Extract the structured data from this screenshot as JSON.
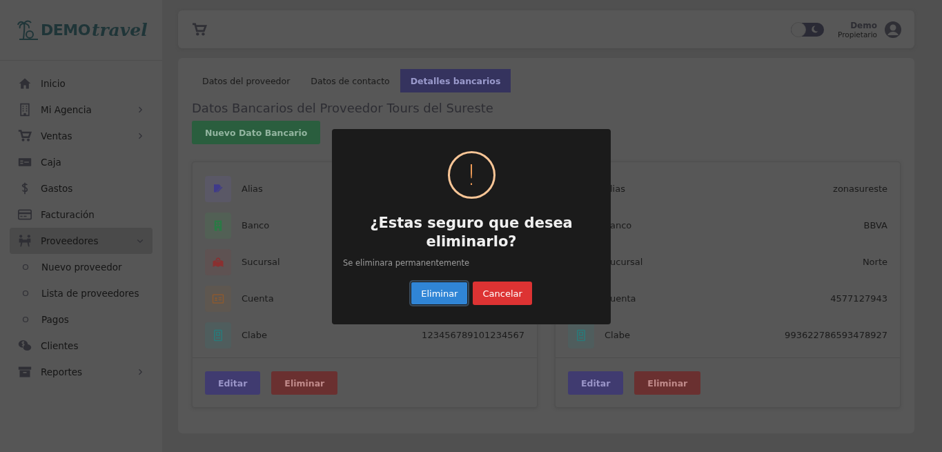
{
  "logo": {
    "text": "DEMO",
    "script": "travel"
  },
  "sidebar": {
    "items": [
      {
        "label": "Inicio",
        "selected": false
      },
      {
        "label": "Mi Agencia",
        "selected": false,
        "expanded": false
      },
      {
        "label": "Ventas",
        "selected": false,
        "expanded": false
      },
      {
        "label": "Caja",
        "selected": false
      },
      {
        "label": "Gastos",
        "selected": false
      },
      {
        "label": "Facturación",
        "selected": false
      },
      {
        "label": "Proveedores",
        "selected": true,
        "expanded": true,
        "children": [
          {
            "label": "Nuevo proveedor",
            "selected": false
          },
          {
            "label": "Lista de proveedores",
            "selected": false
          },
          {
            "label": "Pagos",
            "selected": false
          }
        ]
      },
      {
        "label": "Clientes",
        "selected": false
      },
      {
        "label": "Reportes",
        "selected": false,
        "expanded": false
      }
    ]
  },
  "header": {
    "theme_toggle": {
      "on": false
    },
    "user": {
      "name": "Demo",
      "role": "Propietario"
    }
  },
  "tabs": [
    {
      "label": "Datos del proveedor",
      "selected": false
    },
    {
      "label": "Datos de contacto",
      "selected": false
    },
    {
      "label": "Detalles bancarios",
      "selected": true
    }
  ],
  "page_title": "Datos Bancarios del Proveedor Tours del Sureste",
  "new_button": "Nuevo Dato Bancario",
  "cards": [
    {
      "rows": [
        {
          "label": "Alias"
        },
        {
          "label": "Banco"
        },
        {
          "label": "Sucursal"
        },
        {
          "label": "Cuenta"
        },
        {
          "label": "Clabe",
          "value": "123456789101234567"
        }
      ],
      "buttons": [
        "Editar",
        "Eliminar"
      ]
    },
    {
      "rows": [
        {
          "label": "lias",
          "value": "zonasureste",
          "covered": true
        },
        {
          "label": "anco",
          "value": "BBVA",
          "covered": true
        },
        {
          "label": "ucursal",
          "value": "Norte",
          "covered": true
        },
        {
          "label": "uenta",
          "value": "4577127943",
          "covered": true
        },
        {
          "label": "Clabe",
          "value": "993622786593478927",
          "covered": false
        }
      ],
      "buttons": [
        "Editar",
        "Eliminar"
      ]
    }
  ],
  "dialog": {
    "icon": "!",
    "title": "¿Estas seguro que desea eliminarlo?",
    "text": "Se eliminara permanentemente",
    "buttons": [
      {
        "label": "Eliminar",
        "kind": "confirm",
        "focused": true
      },
      {
        "label": "Cancelar",
        "kind": "cancel",
        "focused": false
      }
    ]
  }
}
